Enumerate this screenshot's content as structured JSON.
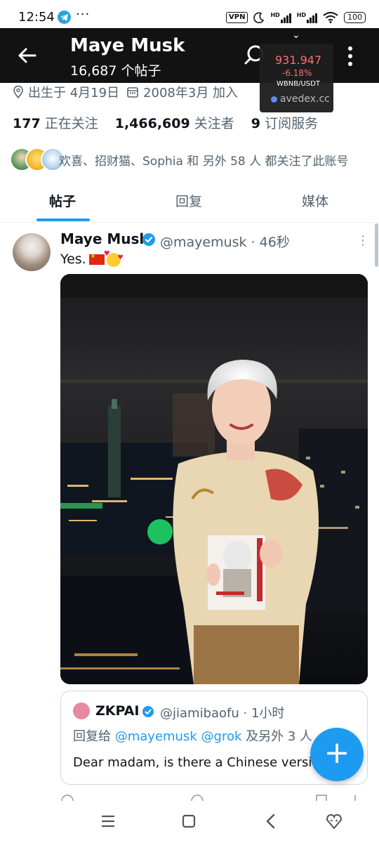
{
  "status_bar": {
    "time": "12:54",
    "dots": "···",
    "vpn": "VPN",
    "net1": "HD",
    "net2": "HD",
    "battery": "100"
  },
  "header": {
    "name": "Maye Musk",
    "post_count": "16,687 个帖子"
  },
  "ticker": {
    "price": "931.947",
    "change": "-6.18%",
    "pair": "WBNB/USDT",
    "site": "avedex.cc"
  },
  "profile": {
    "birthday": "出生于 4月19日",
    "joined": "2008年3月 加入",
    "following_count": "177",
    "following_label": "正在关注",
    "followers_count": "1,466,609",
    "followers_label": "关注者",
    "subs_count": "9",
    "subs_label": "订阅服务",
    "followed_by": "欢喜、招财猫、Sophia 和 另外 58 人 都关注了此账号"
  },
  "tabs": [
    {
      "label": "帖子"
    },
    {
      "label": "回复"
    },
    {
      "label": "媒体"
    }
  ],
  "tweet": {
    "name": "Maye Musk",
    "handle": "@mayemusk · 46秒",
    "text": "Yes."
  },
  "quote": {
    "name": "ZKPAI",
    "handle": "@jiamibaofu · 1小时",
    "reply_prefix": "回复给",
    "mention1": "@mayemusk",
    "mention2": "@grok",
    "reply_suffix": "及另外 3 人",
    "text": "Dear madam, is there a Chinese version"
  },
  "colors": {
    "accent": "#1d9bf0",
    "ticker_red": "#ff6b73"
  },
  "icons": [
    "back-arrow-icon",
    "search-icon",
    "more-icon",
    "location-icon",
    "calendar-icon",
    "verified-icon",
    "compose-plus-icon",
    "menu-lines-icon",
    "home-square-icon",
    "back-chevron-icon",
    "assistant-icon"
  ]
}
